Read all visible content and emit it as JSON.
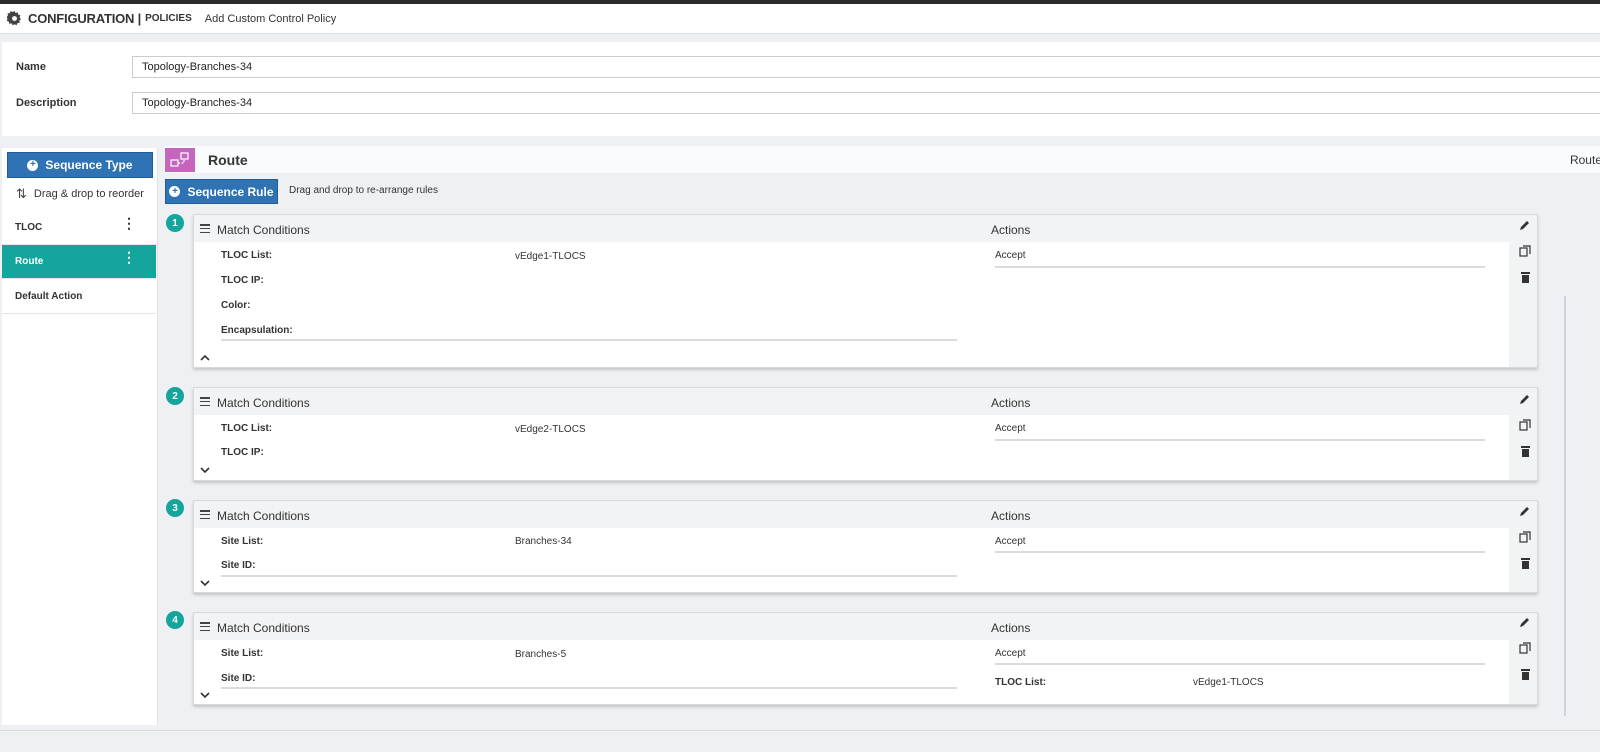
{
  "header": {
    "title": "CONFIGURATION |",
    "section": "POLICIES",
    "page": "Add Custom Control Policy"
  },
  "form": {
    "name_label": "Name",
    "name_value": "Topology-Branches-34",
    "description_label": "Description",
    "description_value": "Topology-Branches-34"
  },
  "sidebar": {
    "sequence_type_label": "Sequence Type",
    "drag_hint": "Drag & drop to reorder",
    "items": [
      {
        "label": "TLOC"
      },
      {
        "label": "Route"
      },
      {
        "label": "Default Action"
      }
    ]
  },
  "route_panel": {
    "title": "Route",
    "right_label": "Route",
    "sequence_rule_label": "Sequence Rule",
    "rule_hint": "Drag and drop to re-arrange rules"
  },
  "rules": [
    {
      "number": "1",
      "match_title": "Match Conditions",
      "actions_title": "Actions",
      "conditions": [
        {
          "label": "TLOC List:",
          "value": "vEdge1-TLOCS"
        },
        {
          "label": "TLOC IP:",
          "value": ""
        },
        {
          "label": "Color:",
          "value": ""
        },
        {
          "label": "Encapsulation:",
          "value": ""
        }
      ],
      "action": "Accept"
    },
    {
      "number": "2",
      "match_title": "Match Conditions",
      "actions_title": "Actions",
      "conditions": [
        {
          "label": "TLOC List:",
          "value": "vEdge2-TLOCS"
        },
        {
          "label": "TLOC IP:",
          "value": ""
        }
      ],
      "action": "Accept"
    },
    {
      "number": "3",
      "match_title": "Match Conditions",
      "actions_title": "Actions",
      "conditions": [
        {
          "label": "Site List:",
          "value": "Branches-34"
        },
        {
          "label": "Site ID:",
          "value": ""
        }
      ],
      "action": "Accept"
    },
    {
      "number": "4",
      "match_title": "Match Conditions",
      "actions_title": "Actions",
      "conditions": [
        {
          "label": "Site List:",
          "value": "Branches-5"
        },
        {
          "label": "Site ID:",
          "value": ""
        }
      ],
      "action": "Accept",
      "extra_action_label": "TLOC List:",
      "extra_action_value": "vEdge1-TLOCS"
    }
  ],
  "icons": {
    "gear": "gear-icon",
    "drag": "reorder-arrows-icon",
    "route": "route-icon",
    "edit": "pencil-icon",
    "copy": "copy-icon",
    "delete": "trash-icon"
  },
  "colors": {
    "primary": "#2f73b5",
    "accent": "#14a59c",
    "route_icon": "#c565be"
  }
}
